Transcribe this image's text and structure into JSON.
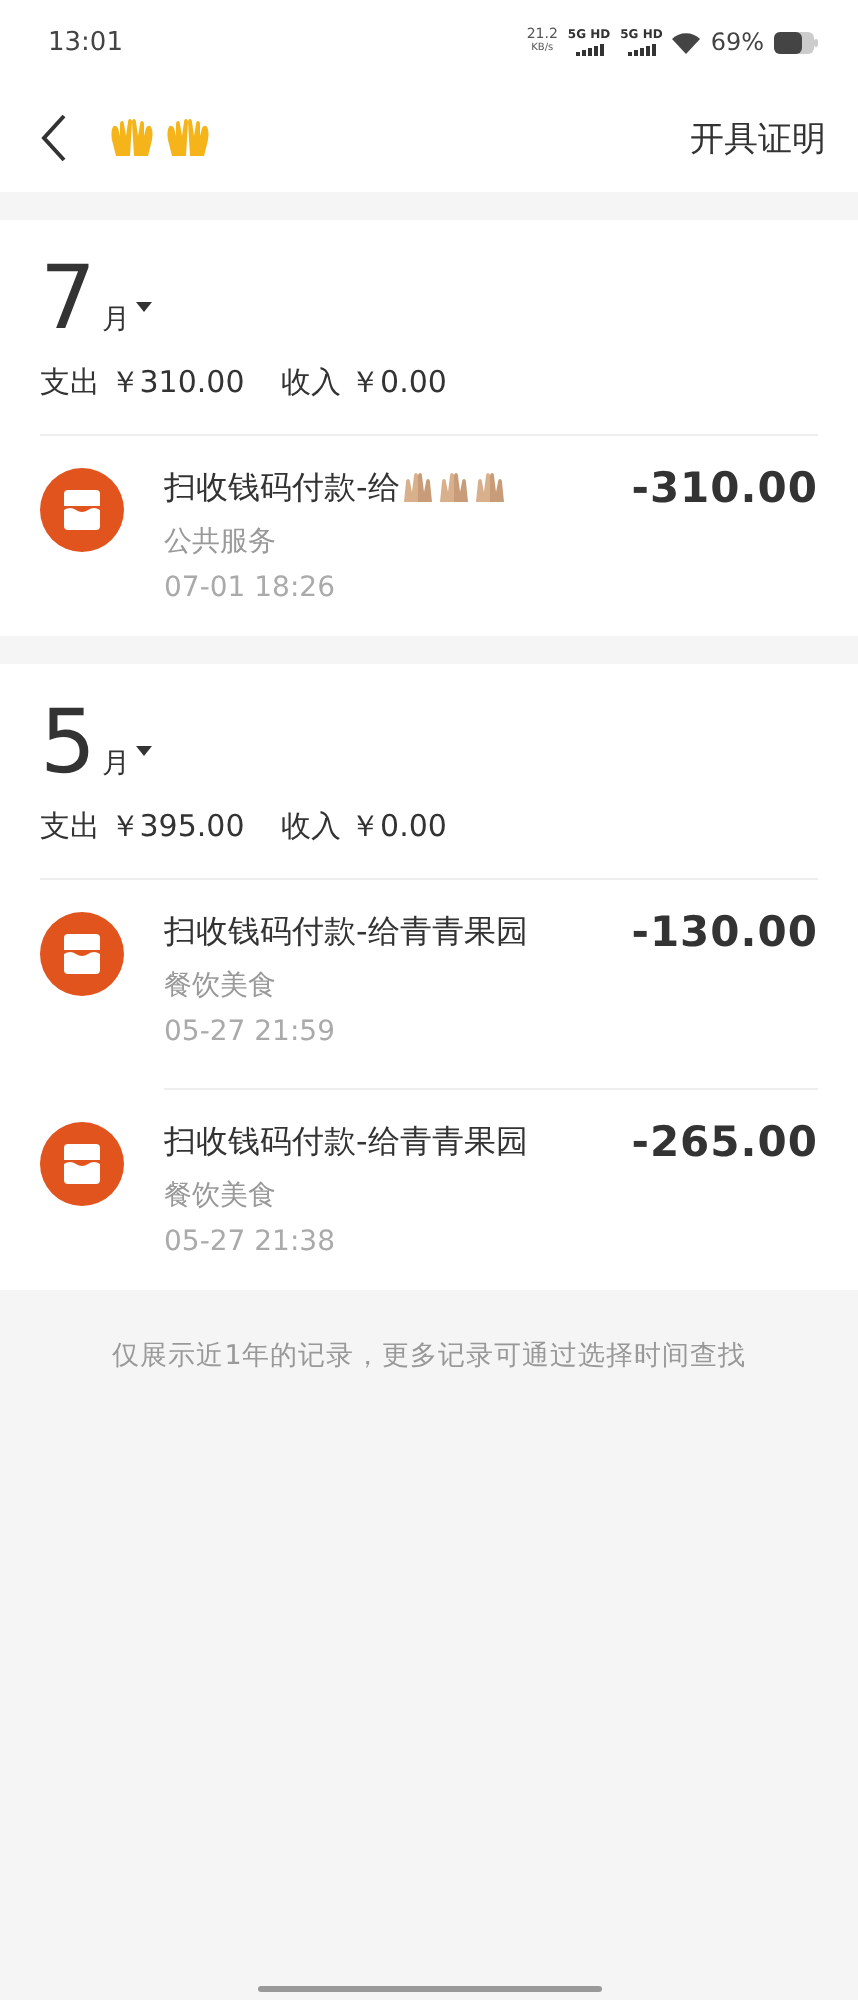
{
  "status_bar": {
    "time": "13:01",
    "net_speed": "21.2",
    "net_unit": "KB/s",
    "signal_1": "5G HD",
    "signal_2": "5G HD",
    "battery": "69%"
  },
  "header": {
    "action": "开具证明"
  },
  "months": [
    {
      "month": "7",
      "unit": "月",
      "expense_label": "支出",
      "expense": "￥310.00",
      "income_label": "收入",
      "income": "￥0.00",
      "items": [
        {
          "title": "扫收钱码付款-给",
          "title_icons": [
            {
              "kind": "hands"
            },
            {
              "kind": "hands"
            },
            {
              "kind": "hands"
            }
          ],
          "category": "公共服务",
          "time": "07-01  18:26",
          "amount": "-310.00"
        }
      ]
    },
    {
      "month": "5",
      "unit": "月",
      "expense_label": "支出",
      "expense": "￥395.00",
      "income_label": "收入",
      "income": "￥0.00",
      "items": [
        {
          "title": "扫收钱码付款-给青青果园",
          "category": "餐饮美食",
          "time": "05-27  21:59",
          "amount": "-130.00"
        },
        {
          "title": "扫收钱码付款-给青青果园",
          "category": "餐饮美食",
          "time": "05-27  21:38",
          "amount": "-265.00"
        }
      ]
    }
  ],
  "footer": "仅展示近1年的记录，更多记录可通过选择时间查找"
}
